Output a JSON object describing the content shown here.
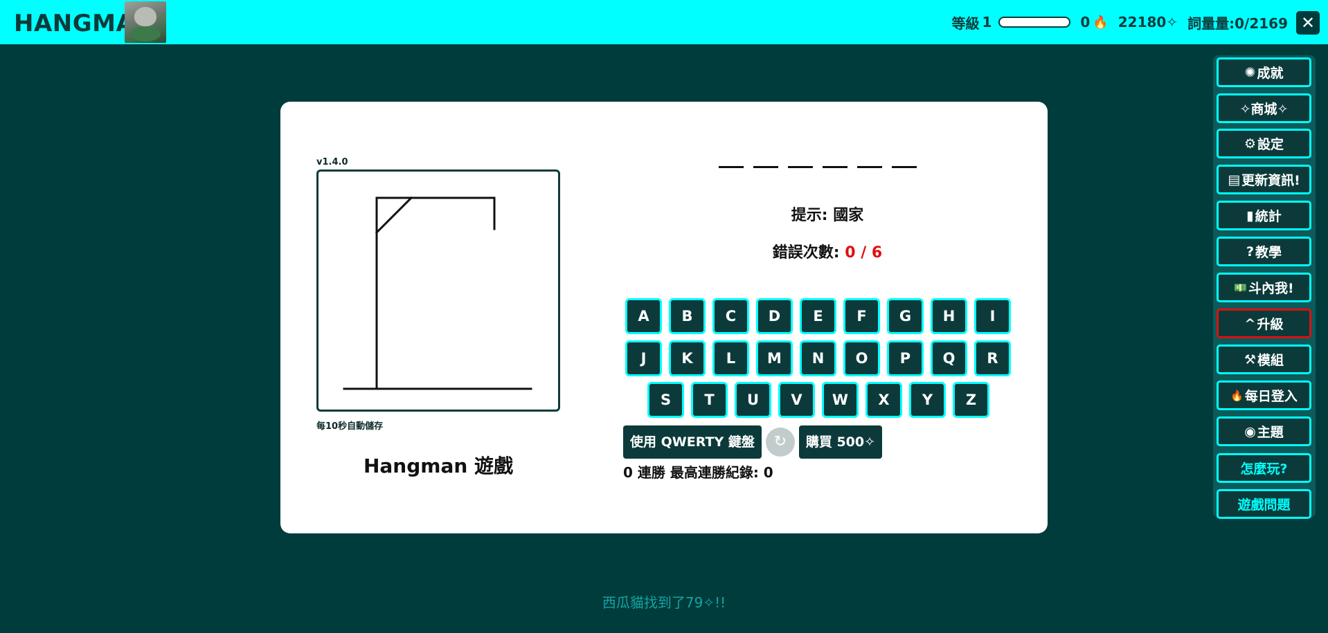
{
  "header": {
    "title": "HANGMAN",
    "level_label": "等級",
    "level_value": "1",
    "level_progress_percent": 0,
    "streak_count": "0",
    "streak_icon": "🔥",
    "currency": "22180✧",
    "vocab": "詞量量:0/2169",
    "close_symbol": "✕",
    "colors": {
      "bar": "#00ffff",
      "text": "#0c3a3a"
    }
  },
  "game": {
    "version": "v1.4.0",
    "autosave": "每10秒自動儲存",
    "title": "Hangman 遊戲",
    "word_length": 6,
    "hint_label": "提示:",
    "hint_value": "國家",
    "wrong_label": "錯誤次數:",
    "wrong_value": "0 / 6",
    "keyboard": [
      [
        "A",
        "B",
        "C",
        "D",
        "E",
        "F",
        "G",
        "H",
        "I"
      ],
      [
        "J",
        "K",
        "L",
        "M",
        "N",
        "O",
        "P",
        "Q",
        "R"
      ],
      [
        "S",
        "T",
        "U",
        "V",
        "W",
        "X",
        "Y",
        "Z"
      ]
    ],
    "qwerty_label": "使用 QWERTY 鍵盤",
    "reset_symbol": "↻",
    "buy_label": "購買 500✧",
    "streak_text": "0 連勝 最高連勝紀錄: 0"
  },
  "menu": [
    {
      "icon": "✺",
      "icon_name": "badge-icon",
      "label": "成就"
    },
    {
      "icon": "",
      "icon_name": "",
      "label": "✧商城✧"
    },
    {
      "icon": "⚙",
      "icon_name": "gear-icon",
      "label": "設定"
    },
    {
      "icon": "▤",
      "icon_name": "newspaper-icon",
      "label": "更新資訊!"
    },
    {
      "icon": "▮",
      "icon_name": "bar-chart-icon",
      "label": "統計"
    },
    {
      "icon": "?",
      "icon_name": "question-icon",
      "label": "教學"
    },
    {
      "icon": "💵",
      "icon_name": "money-icon",
      "label": "斗內我!"
    },
    {
      "icon": "^",
      "icon_name": "caret-up-icon",
      "label": "升級"
    },
    {
      "icon": "⚒",
      "icon_name": "tools-icon",
      "label": "模組"
    },
    {
      "icon": "🔥",
      "icon_name": "fire-icon",
      "label": "每日登入"
    },
    {
      "icon": "◉",
      "icon_name": "palette-icon",
      "label": "主題"
    },
    {
      "icon": "",
      "icon_name": "",
      "label": "怎麼玩?"
    },
    {
      "icon": "",
      "icon_name": "",
      "label": "遊戲問題"
    }
  ],
  "toast": "西瓜貓找到了79✧!!"
}
